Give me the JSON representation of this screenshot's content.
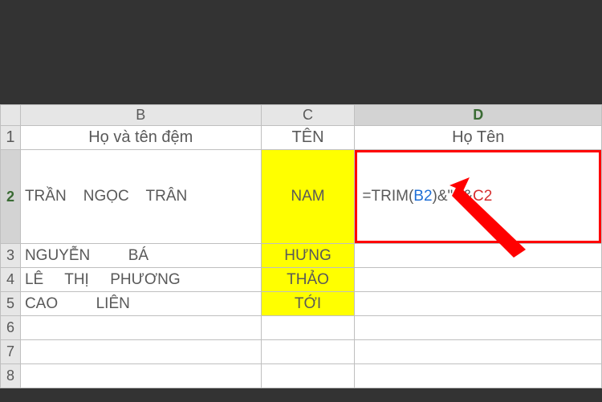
{
  "columns": {
    "B": "B",
    "C": "C",
    "D": "D"
  },
  "rows": [
    "1",
    "2",
    "3",
    "4",
    "5",
    "6",
    "7",
    "8"
  ],
  "header": {
    "B": "Họ và tên đệm",
    "C": "TÊN",
    "D": "Họ Tên"
  },
  "data": {
    "r2": {
      "B": "TRẦN    NGỌC    TRÂN",
      "C": "NAM"
    },
    "r3": {
      "B": "NGUYỄN         BÁ",
      "C": "HƯNG"
    },
    "r4": {
      "B": "LÊ     THỊ     PHƯƠNG",
      "C": "THẢO"
    },
    "r5": {
      "B": "CAO         LIÊN",
      "C": "TỚI"
    }
  },
  "formula": {
    "prefix": "=TRIM(",
    "ref1": "B2",
    "mid": ")&\" \"&",
    "ref2": "C2"
  },
  "chart_data": {
    "type": "table",
    "columns": [
      "Họ và tên đệm",
      "TÊN",
      "Họ Tên"
    ],
    "rows": [
      [
        "TRẦN    NGỌC    TRÂN",
        "NAM",
        "=TRIM(B2)&\" \"&C2"
      ],
      [
        "NGUYỄN         BÁ",
        "HƯNG",
        ""
      ],
      [
        "LÊ     THỊ     PHƯƠNG",
        "THẢO",
        ""
      ],
      [
        "CAO         LIÊN",
        "TỚI",
        ""
      ]
    ]
  }
}
